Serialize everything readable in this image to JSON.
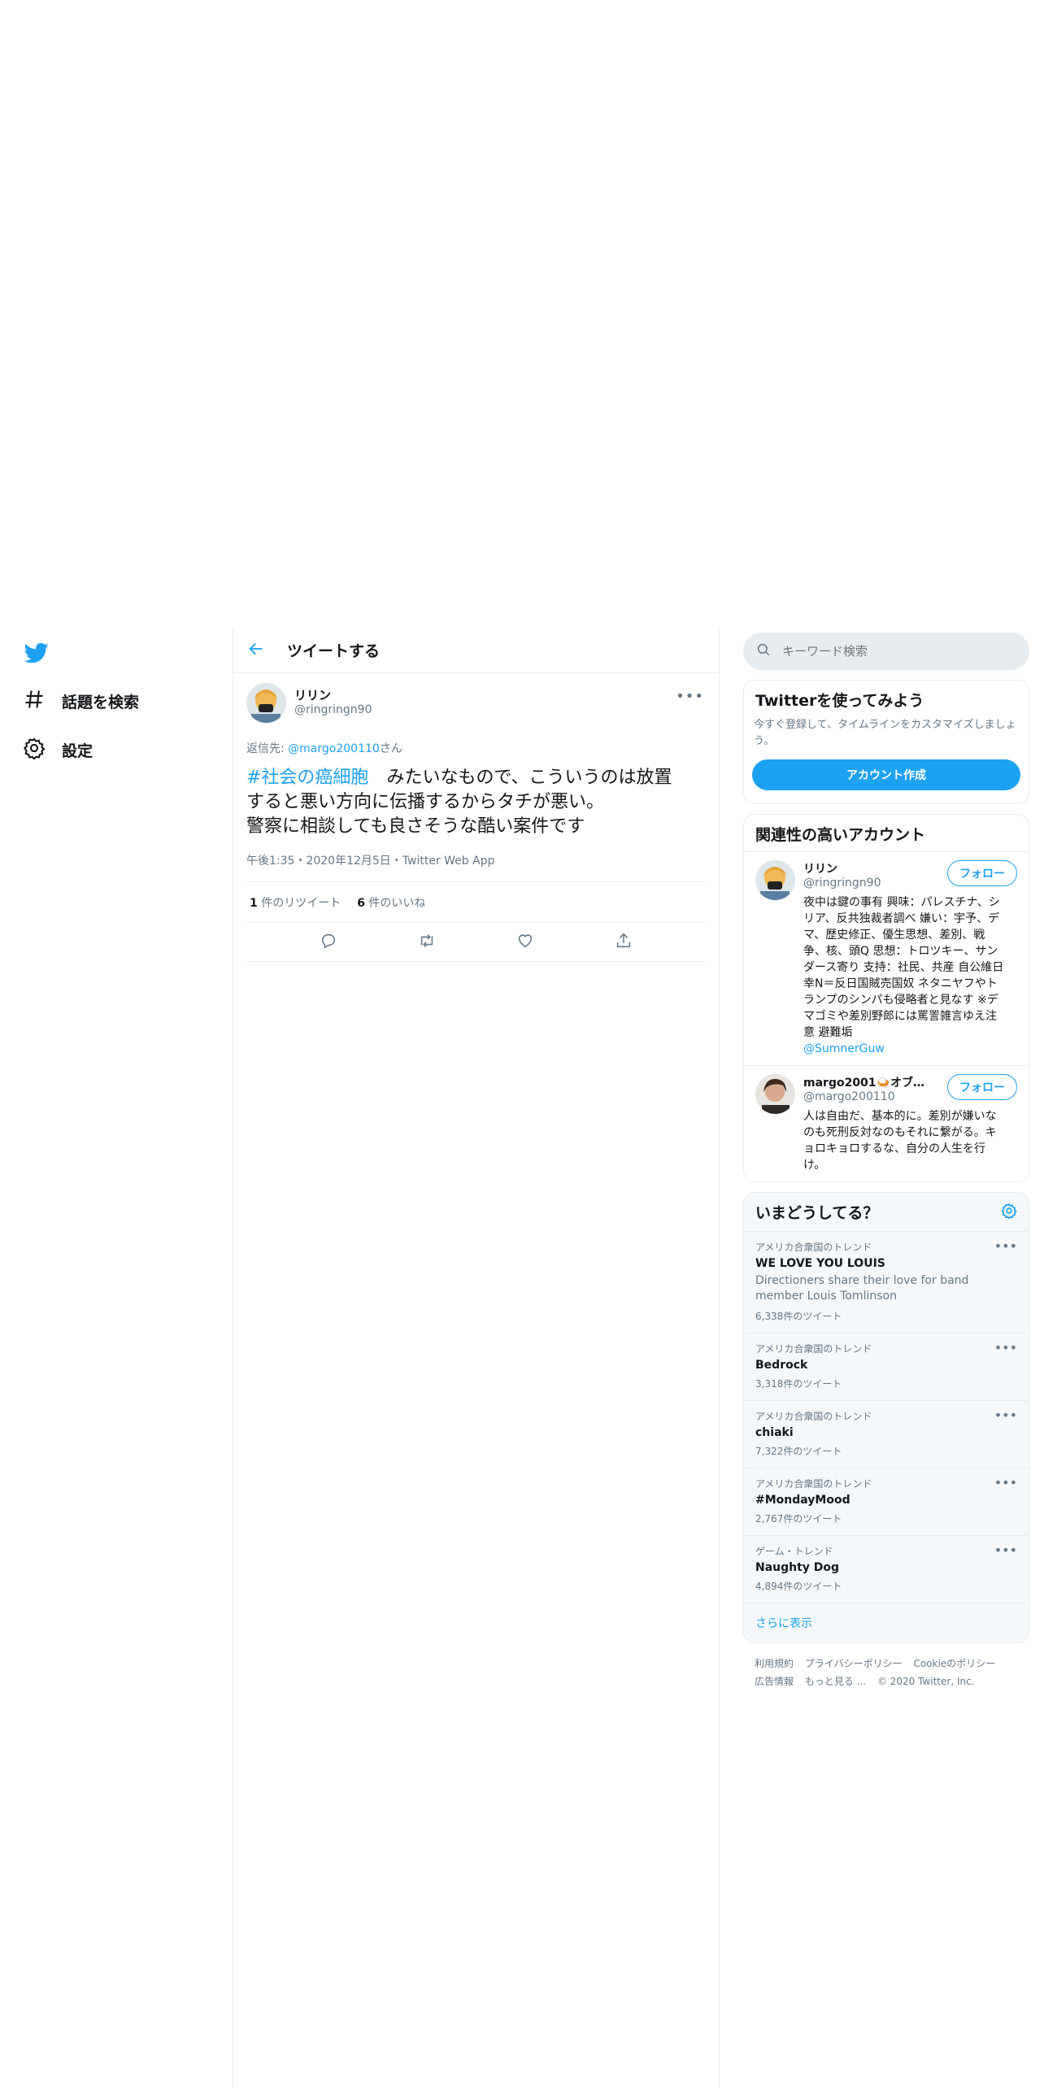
{
  "nav": {
    "explore_label": "話題を検索",
    "settings_label": "設定"
  },
  "header": {
    "title": "ツイートする"
  },
  "tweet": {
    "author_name": "リリン",
    "author_handle": "@ringringn90",
    "reply_prefix": "返信先: ",
    "reply_to": "@margo200110",
    "reply_suffix": "さん",
    "hashtag": "#社会の癌細胞",
    "text_line1": "　みたいなもので、こういうのは放置",
    "text_line2": "すると悪い方向に伝播するからタチが悪い。",
    "text_line3": "警察に相談しても良さそうな酷い案件です",
    "time": "午後1:35・2020年12月5日・Twitter Web App",
    "retweets_count": "1",
    "retweets_label": " 件のリツイート",
    "likes_count": "6",
    "likes_label": " 件のいいね"
  },
  "search": {
    "placeholder": "キーワード検索"
  },
  "signup": {
    "title": "Twitterを使ってみよう",
    "subtitle": "今すぐ登録して、タイムラインをカスタマイズしましょう。",
    "button": "アカウント作成"
  },
  "related": {
    "title": "関連性の高いアカウント",
    "follow_label": "フォロー",
    "accounts": [
      {
        "name": "リリン",
        "handle": "@ringringn90",
        "bio": "夜中は鍵の事有 興味：パレスチナ、シリア、反共独裁者調べ 嫌い：宇予、デマ、歴史修正、優生思想、差別、戦争、核、頭Q 思想：トロツキー、サンダース寄り 支持：社民、共産 自公維日幸N＝反日国賊売国奴 ネタニヤフやトランプのシンパも侵略者と見なす ※デマゴミや差別野郎には罵詈雑言ゆえ注意 避難垢",
        "bio_link": "@SumnerGuw"
      },
      {
        "name": "margo2001🍛オブ・...",
        "handle": "@margo200110",
        "bio": "人は自由だ、基本的に。差別が嫌いなのも死刑反対なのもそれに繋がる。キョロキョロするな、自分の人生を行け。"
      }
    ]
  },
  "trends": {
    "title": "いまどうしてる？",
    "items": [
      {
        "context": "アメリカ合衆国のトレンド",
        "name": "WE LOVE YOU LOUIS",
        "desc": "Directioners share their love for band member Louis Tomlinson",
        "count": "6,338件のツイート"
      },
      {
        "context": "アメリカ合衆国のトレンド",
        "name": "Bedrock",
        "count": "3,318件のツイート"
      },
      {
        "context": "アメリカ合衆国のトレンド",
        "name": "chiaki",
        "count": "7,322件のツイート"
      },
      {
        "context": "アメリカ合衆国のトレンド",
        "name": "#MondayMood",
        "count": "2,767件のツイート"
      },
      {
        "context": "ゲーム・トレンド",
        "name": "Naughty Dog",
        "count": "4,894件のツイート"
      }
    ],
    "show_more": "さらに表示"
  },
  "footer": {
    "terms": "利用規約",
    "privacy": "プライバシーポリシー",
    "cookie": "Cookieのポリシー",
    "ads": "広告情報",
    "more": "もっと見る ...",
    "copyright": "© 2020 Twitter, Inc."
  },
  "colors": {
    "accent": "#1da1f2",
    "muted": "#657786",
    "border": "#e6ecf0"
  }
}
